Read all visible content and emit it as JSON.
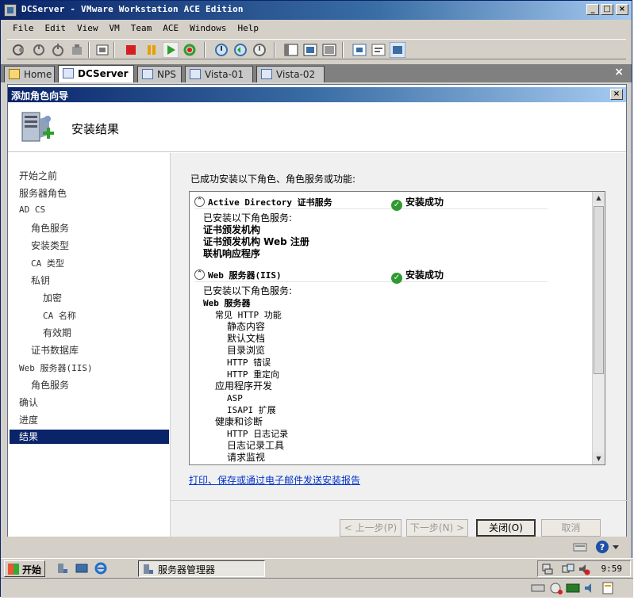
{
  "window": {
    "title": "DCServer - VMware Workstation ACE Edition",
    "min_label": "_",
    "max_label": "□",
    "close_label": "×"
  },
  "menu": [
    "File",
    "Edit",
    "View",
    "VM",
    "Team",
    "ACE",
    "Windows",
    "Help"
  ],
  "tabs": [
    {
      "label": "Home",
      "active": false
    },
    {
      "label": "DCServer",
      "active": true
    },
    {
      "label": "NPS",
      "active": false
    },
    {
      "label": "Vista-01",
      "active": false
    },
    {
      "label": "Vista-02",
      "active": false
    }
  ],
  "tab_close_label": "×",
  "wizard": {
    "title": "添加角色向导",
    "close_label": "×",
    "heading": "安装结果",
    "nav": [
      {
        "label": "开始之前",
        "level": 1
      },
      {
        "label": "服务器角色",
        "level": 1
      },
      {
        "label": "AD CS",
        "level": 1
      },
      {
        "label": "角色服务",
        "level": 2
      },
      {
        "label": "安装类型",
        "level": 2
      },
      {
        "label": "CA 类型",
        "level": 2
      },
      {
        "label": "私钥",
        "level": 2
      },
      {
        "label": "加密",
        "level": 3
      },
      {
        "label": "CA 名称",
        "level": 3
      },
      {
        "label": "有效期",
        "level": 3
      },
      {
        "label": "证书数据库",
        "level": 2
      },
      {
        "label": "Web 服务器(IIS)",
        "level": 1
      },
      {
        "label": "角色服务",
        "level": 2
      },
      {
        "label": "确认",
        "level": 1
      },
      {
        "label": "进度",
        "level": 1
      },
      {
        "label": "结果",
        "level": 1,
        "selected": true
      }
    ],
    "intro": "已成功安装以下角色、角色服务或功能:",
    "collapse_glyph": "⌃",
    "check_glyph": "✓",
    "section1": {
      "name": "Active Directory 证书服务",
      "status": "安装成功",
      "caption": "已安装以下角色服务:",
      "items": [
        "证书颁发机构",
        "证书颁发机构 Web 注册",
        "联机响应程序"
      ]
    },
    "section2": {
      "name": "Web 服务器(IIS)",
      "status": "安装成功",
      "caption": "已安装以下角色服务:",
      "root": "Web 服务器",
      "groups": [
        {
          "label": "常见 HTTP 功能",
          "items": [
            "静态内容",
            "默认文档",
            "目录浏览",
            "HTTP 错误",
            "HTTP 重定向"
          ]
        },
        {
          "label": "应用程序开发",
          "items": [
            "ASP",
            "ISAPI 扩展"
          ]
        },
        {
          "label": "健康和诊断",
          "items": [
            "HTTP 日志记录",
            "日志记录工具",
            "请求监视"
          ]
        }
      ]
    },
    "report_link": "打印、保存或通过电子邮件发送安装报告",
    "buttons": {
      "prev": "< 上一步(P)",
      "next": "下一步(N) >",
      "close": "关闭(O)",
      "cancel": "取消"
    },
    "scroll_up": "▲",
    "scroll_down": "▼"
  },
  "taskbar": {
    "start_label": "开始",
    "task_label": "服务器管理器",
    "clock": "9:59"
  },
  "colors": {
    "title_bar": "#0a246a",
    "selected_nav": "#0a246a",
    "link": "#0033cc",
    "success": "#2f9a2f"
  }
}
